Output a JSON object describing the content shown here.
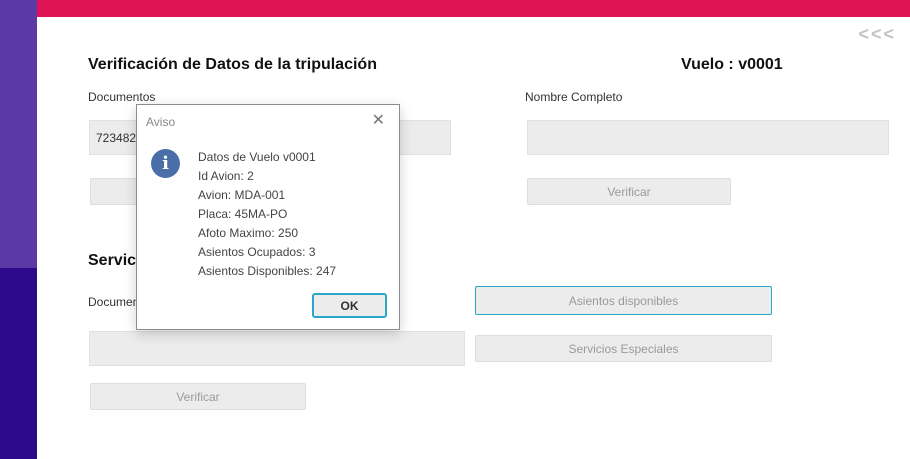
{
  "header": {
    "back_label": "<<<"
  },
  "crew": {
    "title": "Verificación de Datos de la tripulación",
    "flight_label": "Vuelo : v0001",
    "documents_label": "Documentos",
    "document_value": "7234823",
    "fullname_label": "Nombre Completo",
    "fullname_value": "",
    "verify_label": "Verificar"
  },
  "services": {
    "title": "Servicios",
    "documents_label": "Documentos",
    "document_value": "",
    "verify_label": "Verificar",
    "available_seats_label": "Asientos disponibles",
    "special_services_label": "Servicios Especiales"
  },
  "dialog": {
    "title": "Aviso",
    "close_symbol": "✕",
    "icon": "info-icon",
    "lines": [
      "Datos de Vuelo v0001",
      "Id Avion: 2",
      "Avion: MDA-001",
      "Placa: 45MA-PO",
      "Afoto Maximo: 250",
      "Asientos Ocupados: 3",
      "Asientos Disponibles: 247"
    ],
    "ok_label": "OK"
  },
  "colors": {
    "topbar": "#df1457",
    "sidebar_top": "#5b3aa8",
    "sidebar_bottom": "#2d0a8c",
    "focus": "#2aa7c6"
  }
}
